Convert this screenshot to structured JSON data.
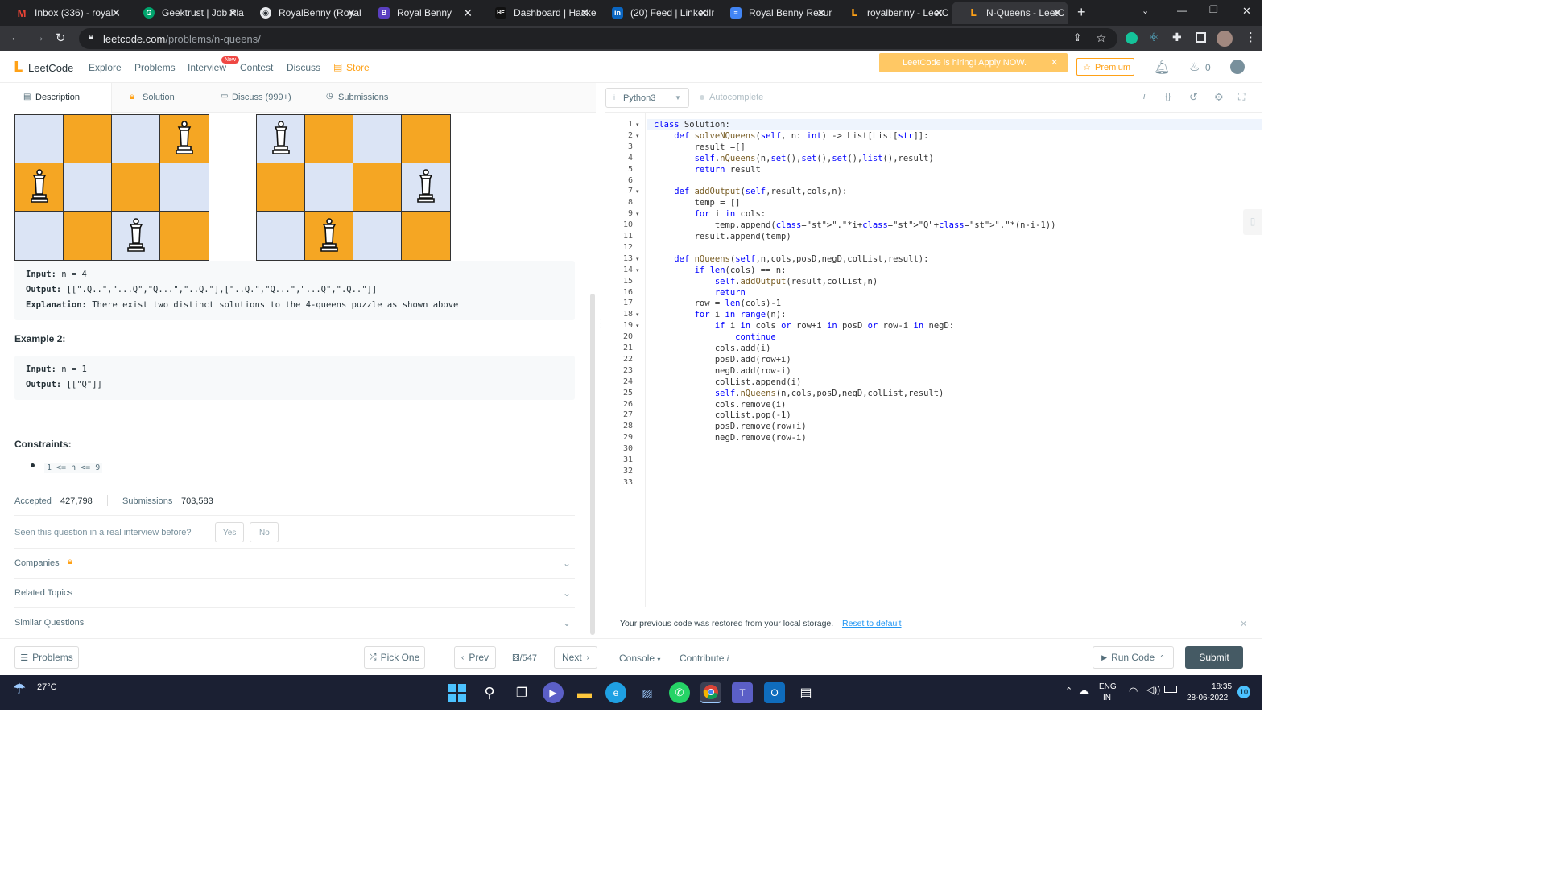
{
  "browser": {
    "tabs": [
      {
        "title": "Inbox (336) - royal",
        "icon": "gmail-icon",
        "color": "#ea4335",
        "letter": "M"
      },
      {
        "title": "Geektrust | Job Pla",
        "icon": "geektrust-icon",
        "color": "#00a36c",
        "letter": "G"
      },
      {
        "title": "RoyalBenny (Royal",
        "icon": "github-icon",
        "color": "#24292e",
        "letter": "◉"
      },
      {
        "title": "Royal Benny",
        "icon": "b-icon",
        "color": "#5a3fc0",
        "letter": "B"
      },
      {
        "title": "Dashboard | Hacke",
        "icon": "hackerearth-icon",
        "color": "#111111",
        "letter": "HE"
      },
      {
        "title": "(20) Feed | LinkedIn",
        "icon": "linkedin-icon",
        "color": "#0a66c2",
        "letter": "in"
      },
      {
        "title": "Royal Benny Resun",
        "icon": "docs-icon",
        "color": "#4285f4",
        "letter": "≡"
      },
      {
        "title": "royalbenny - LeetC",
        "icon": "leetcode-icon",
        "color": "#ffa116",
        "letter": "L"
      },
      {
        "title": "N-Queens - LeetC",
        "icon": "leetcode-icon",
        "color": "#ffa116",
        "letter": "L"
      }
    ],
    "url_host": "leetcode.com",
    "url_path": "/problems/n-queens/"
  },
  "lc": {
    "logo": "LeetCode",
    "nav": [
      "Explore",
      "Problems",
      "Interview",
      "Contest",
      "Discuss",
      "Store"
    ],
    "new_badge": "New",
    "banner": "LeetCode is hiring! Apply NOW.",
    "premium": "Premium",
    "coins": "0"
  },
  "left_tabs": [
    "Description",
    "Solution",
    "Discuss (999+)",
    "Submissions"
  ],
  "example1": {
    "input_label": "Input:",
    "input": "n = 4",
    "output_label": "Output:",
    "output": "[[\".Q..\",\"...Q\",\"Q...\",\"..Q.\"],[\"..Q.\",\"Q...\",\"...Q\",\".Q..\"]]",
    "explanation_label": "Explanation:",
    "explanation": "There exist two distinct solutions to the 4-queens puzzle as shown above"
  },
  "example2": {
    "heading": "Example 2:",
    "input_label": "Input:",
    "input": "n = 1",
    "output_label": "Output:",
    "output": "[[\"Q\"]]"
  },
  "constraints": {
    "heading": "Constraints:",
    "item": "1 <= n <= 9"
  },
  "stats": {
    "accepted_label": "Accepted",
    "accepted": "427,798",
    "submissions_label": "Submissions",
    "submissions": "703,583"
  },
  "interview": {
    "question": "Seen this question in a real interview before?",
    "yes": "Yes",
    "no": "No"
  },
  "accordions": [
    "Companies",
    "Related Topics",
    "Similar Questions"
  ],
  "editor": {
    "language": "Python3",
    "autocomplete": "Autocomplete",
    "line_numbers": [
      "1",
      "2",
      "3",
      "4",
      "5",
      "6",
      "7",
      "8",
      "9",
      "10",
      "11",
      "12",
      "13",
      "14",
      "15",
      "16",
      "17",
      "18",
      "19",
      "20",
      "21",
      "22",
      "23",
      "24",
      "25",
      "26",
      "27",
      "28",
      "29",
      "30",
      "31",
      "32",
      "33"
    ],
    "lines": [
      "class Solution:",
      "    def solveNQueens(self, n: int) -> List[List[str]]:",
      "        result =[]",
      "        self.nQueens(n,set(),set(),set(),list(),result)",
      "        return result",
      "",
      "    def addOutput(self,result,cols,n):",
      "        temp = []",
      "        for i in cols:",
      "            temp.append(\".\"*i+\"Q\"+\".\"*(n-i-1))",
      "        result.append(temp)",
      "",
      "    def nQueens(self,n,cols,posD,negD,colList,result):",
      "        if len(cols) == n:",
      "            self.addOutput(result,colList,n)",
      "            return",
      "        row = len(cols)-1",
      "        for i in range(n):",
      "            if i in cols or row+i in posD or row-i in negD:",
      "                continue",
      "            cols.add(i)",
      "            posD.add(row+i)",
      "            negD.add(row-i)",
      "            colList.append(i)",
      "            self.nQueens(n,cols,posD,negD,colList,result)",
      "            cols.remove(i)",
      "            colList.pop(-1)",
      "            posD.remove(row+i)",
      "            negD.remove(row-i)",
      "",
      "",
      "",
      ""
    ],
    "restore_msg": "Your previous code was restored from your local storage.",
    "reset_link": "Reset to default"
  },
  "bottom": {
    "problems": "Problems",
    "pick_one": "Pick One",
    "prev": "Prev",
    "page": "/547",
    "next": "Next",
    "console": "Console",
    "contribute": "Contribute",
    "run_code": "Run Code",
    "submit": "Submit"
  },
  "taskbar": {
    "weather": "27°C",
    "lang1": "ENG",
    "lang2": "IN",
    "time": "18:35",
    "date": "28-06-2022",
    "notif": "10"
  }
}
